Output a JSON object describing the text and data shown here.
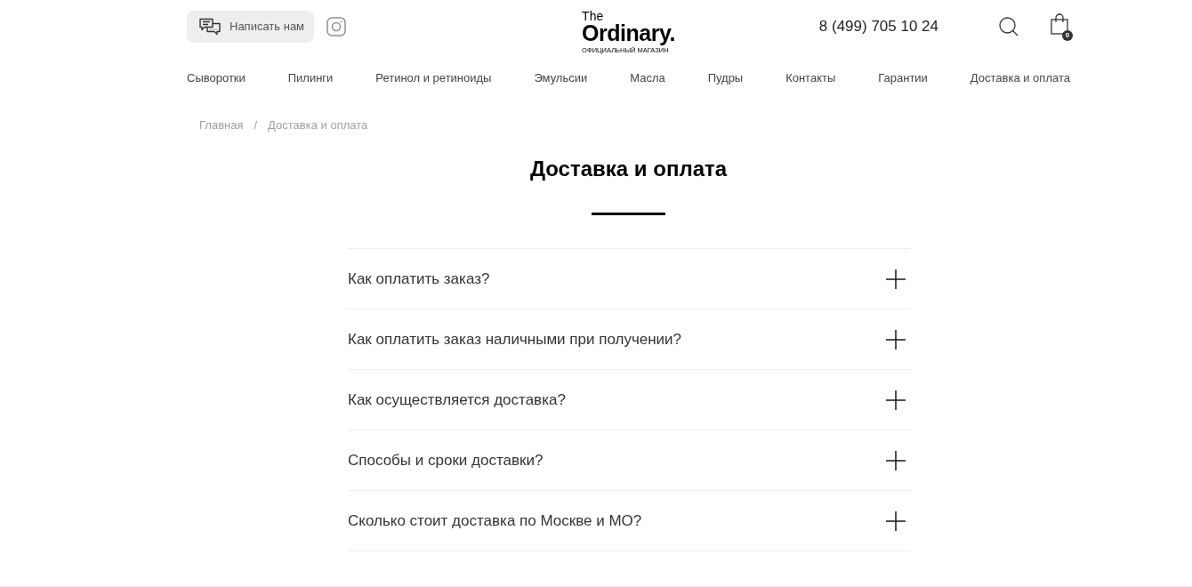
{
  "header": {
    "contact_button": {
      "label": "Написать нам"
    },
    "logo": {
      "brand_top": "The",
      "brand_main": "Ordinary.",
      "subtitle": "ОФИЦИАЛЬНЫЙ МАГАЗИН"
    },
    "phone": "8 (499) 705 10 24",
    "cart": {
      "count": "0"
    }
  },
  "nav": [
    {
      "label": "Сыворотки"
    },
    {
      "label": "Пилинги"
    },
    {
      "label": "Ретинол и ретиноиды"
    },
    {
      "label": "Эмульсии"
    },
    {
      "label": "Масла"
    },
    {
      "label": "Пудры"
    },
    {
      "label": "Контакты"
    },
    {
      "label": "Гарантии"
    },
    {
      "label": "Доставка и оплата"
    }
  ],
  "breadcrumbs": {
    "items": [
      {
        "label": "Главная"
      },
      {
        "label": "Доставка и оплата"
      }
    ],
    "separator": "/"
  },
  "page_title": "Доставка и оплата",
  "faq": [
    {
      "question": "Как оплатить заказ?",
      "expanded": false
    },
    {
      "question": "Как оплатить заказ наличными при получении?",
      "expanded": false
    },
    {
      "question": "Как осуществляется доставка?",
      "expanded": false
    },
    {
      "question": "Способы и сроки доставки?",
      "expanded": false
    },
    {
      "question": "Сколько стоит доставка по Москве и МО?",
      "expanded": false
    }
  ]
}
